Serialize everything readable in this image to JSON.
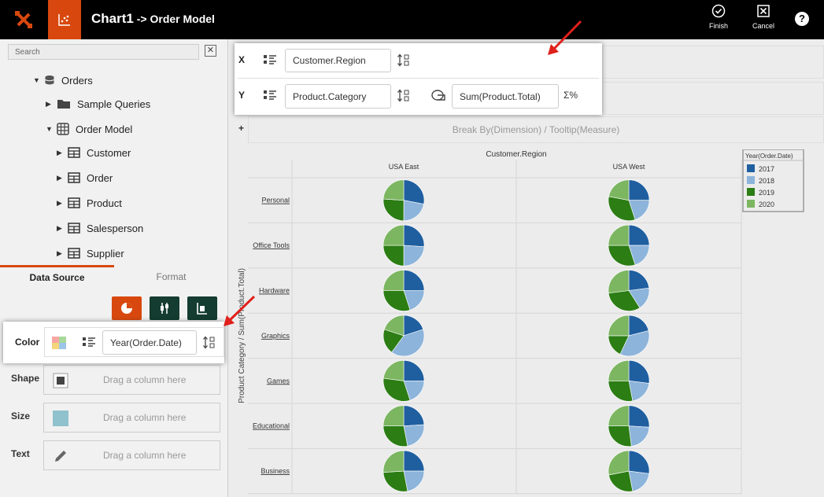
{
  "header": {
    "chart_name": "Chart1",
    "separator": " -> ",
    "model_name": "Order Model",
    "finish_label": "Finish",
    "cancel_label": "Cancel",
    "help_label": "?"
  },
  "search": {
    "placeholder": "Search"
  },
  "tree": {
    "root": "Orders",
    "items": [
      {
        "label": "Sample Queries",
        "icon": "folder-icon"
      },
      {
        "label": "Order Model",
        "icon": "grid-model-icon"
      },
      {
        "label": "Customer",
        "icon": "table-icon"
      },
      {
        "label": "Order",
        "icon": "table-icon"
      },
      {
        "label": "Product",
        "icon": "table-icon"
      },
      {
        "label": "Salesperson",
        "icon": "table-icon"
      },
      {
        "label": "Supplier",
        "icon": "table-icon"
      }
    ]
  },
  "tabs": {
    "data_source": "Data Source",
    "format": "Format"
  },
  "accent": "#d8480e",
  "fields": {
    "x": {
      "label": "X",
      "value": "Customer.Region"
    },
    "y": {
      "label": "Y",
      "dimension": "Product.Category",
      "measure": "Sum(Product.Total)"
    },
    "color": {
      "label": "Color",
      "value": "Year(Order.Date)"
    },
    "shape": {
      "label": "Shape",
      "placeholder": "Drag a column here"
    },
    "size": {
      "label": "Size",
      "placeholder": "Drag a column here"
    },
    "text": {
      "label": "Text",
      "placeholder": "Drag a column here"
    }
  },
  "breakby": {
    "plus": "+",
    "label": "Break By(Dimension) / Tooltip(Measure)"
  },
  "chart_data": {
    "type": "pie",
    "title": "Customer.Region",
    "ylabel": "Product Category / Sum(Product.Total)",
    "columns": [
      "USA East",
      "USA West"
    ],
    "rows": [
      "Personal",
      "Office Tools",
      "Hardware",
      "Graphics",
      "Games",
      "Educational",
      "Business"
    ],
    "legend": {
      "title": "Year(Order.Date)",
      "placement": "top-right",
      "entries": [
        "2017",
        "2018",
        "2019",
        "2020"
      ],
      "colors": [
        "#1f5fa0",
        "#8db4da",
        "#2b7d14",
        "#7cb661"
      ]
    },
    "slices": [
      [
        [
          28,
          22,
          26,
          24
        ],
        [
          25,
          20,
          33,
          22
        ]
      ],
      [
        [
          26,
          24,
          25,
          25
        ],
        [
          25,
          20,
          30,
          25
        ]
      ],
      [
        [
          25,
          20,
          30,
          25
        ],
        [
          23,
          18,
          32,
          27
        ]
      ],
      [
        [
          20,
          40,
          20,
          20
        ],
        [
          21,
          36,
          18,
          25
        ]
      ],
      [
        [
          25,
          20,
          32,
          23
        ],
        [
          27,
          20,
          28,
          25
        ]
      ],
      [
        [
          24,
          23,
          28,
          25
        ],
        [
          26,
          22,
          27,
          25
        ]
      ],
      [
        [
          25,
          22,
          27,
          26
        ],
        [
          27,
          20,
          25,
          28
        ]
      ]
    ]
  }
}
